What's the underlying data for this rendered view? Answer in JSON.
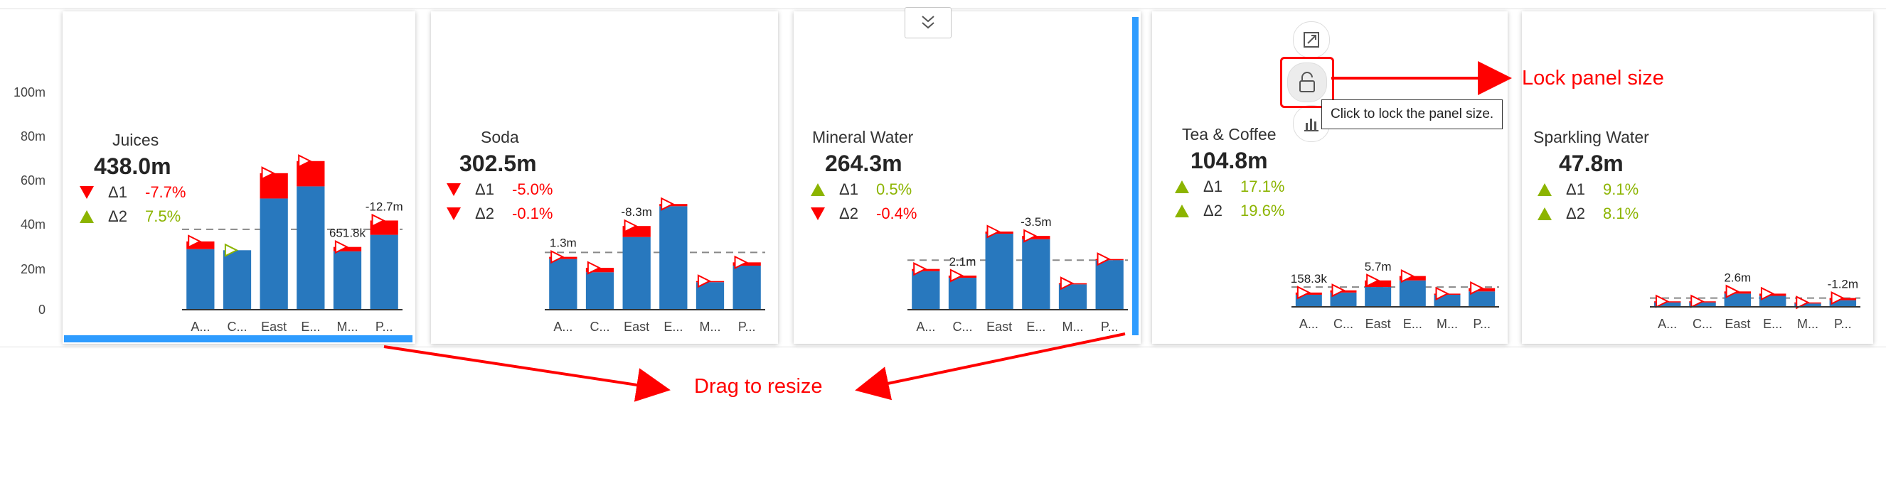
{
  "y_axis": {
    "ticks": [
      "100m",
      "80m",
      "60m",
      "40m",
      "20m",
      "0"
    ]
  },
  "panels": [
    {
      "title": "Juices",
      "total": "438.0m",
      "d1": {
        "label": "Δ1",
        "value": "-7.7%",
        "dir": "down"
      },
      "d2": {
        "label": "Δ2",
        "value": "7.5%",
        "dir": "up"
      }
    },
    {
      "title": "Soda",
      "total": "302.5m",
      "d1": {
        "label": "Δ1",
        "value": "-5.0%",
        "dir": "down"
      },
      "d2": {
        "label": "Δ2",
        "value": "-0.1%",
        "dir": "down"
      }
    },
    {
      "title": "Mineral Water",
      "total": "264.3m",
      "d1": {
        "label": "Δ1",
        "value": "0.5%",
        "dir": "up"
      },
      "d2": {
        "label": "Δ2",
        "value": "-0.4%",
        "dir": "down"
      }
    },
    {
      "title": "Tea & Coffee",
      "total": "104.8m",
      "d1": {
        "label": "Δ1",
        "value": "17.1%",
        "dir": "up"
      },
      "d2": {
        "label": "Δ2",
        "value": "19.6%",
        "dir": "up"
      }
    },
    {
      "title": "Sparkling Water",
      "total": "47.8m",
      "d1": {
        "label": "Δ1",
        "value": "9.1%",
        "dir": "up"
      },
      "d2": {
        "label": "Δ2",
        "value": "8.1%",
        "dir": "up"
      }
    }
  ],
  "chart_data": [
    {
      "type": "bar",
      "title": "Juices",
      "categories": [
        "A...",
        "C...",
        "East",
        "E...",
        "M...",
        "P..."
      ],
      "values": [
        55,
        54,
        101,
        112,
        53,
        68
      ],
      "ref": [
        62,
        54,
        124,
        135,
        57,
        81
      ],
      "avg": 73,
      "annotations": [
        {
          "index": 4,
          "text": "651.8k"
        },
        {
          "index": 5,
          "text": "-12.7m"
        }
      ],
      "ylim": [
        0,
        120
      ]
    },
    {
      "type": "bar",
      "title": "Soda",
      "categories": [
        "A...",
        "C...",
        "East",
        "E...",
        "M...",
        "P..."
      ],
      "values": [
        46,
        34,
        66,
        94,
        25,
        40
      ],
      "ref": [
        48,
        38,
        76,
        96,
        26,
        43
      ],
      "avg": 52,
      "annotations": [
        {
          "index": 0,
          "text": "1.3m"
        },
        {
          "index": 2,
          "text": "-8.3m"
        }
      ],
      "ylim": [
        0,
        120
      ]
    },
    {
      "type": "bar",
      "title": "Mineral Water",
      "categories": [
        "A...",
        "C...",
        "East",
        "E...",
        "M...",
        "P..."
      ],
      "values": [
        35,
        29,
        69,
        64,
        23,
        45
      ],
      "ref": [
        37,
        31,
        71,
        67,
        24,
        46
      ],
      "avg": 45,
      "annotations": [
        {
          "index": 1,
          "text": "2.1m"
        },
        {
          "index": 3,
          "text": "-3.5m"
        }
      ],
      "ylim": [
        0,
        120
      ]
    },
    {
      "type": "bar",
      "title": "Tea & Coffee",
      "categories": [
        "A...",
        "C...",
        "East",
        "E...",
        "M...",
        "P..."
      ],
      "values": [
        11,
        13,
        18,
        24,
        11,
        14
      ],
      "ref": [
        13,
        15,
        24,
        28,
        12,
        17
      ],
      "avg": 18,
      "annotations": [
        {
          "index": 0,
          "text": "158.3k"
        },
        {
          "index": 2,
          "text": "5.7m"
        }
      ],
      "ylim": [
        0,
        120
      ]
    },
    {
      "type": "bar",
      "title": "Sparkling Water",
      "categories": [
        "A...",
        "C...",
        "East",
        "E...",
        "M...",
        "P..."
      ],
      "values": [
        4,
        4,
        12,
        10,
        3,
        6
      ],
      "ref": [
        5,
        5,
        14,
        12,
        4,
        8
      ],
      "avg": 8,
      "annotations": [
        {
          "index": 2,
          "text": "2.6m"
        },
        {
          "index": 5,
          "text": "-1.2m"
        }
      ],
      "ylim": [
        0,
        120
      ]
    }
  ],
  "tooltip": "Click to lock the panel size.",
  "annotations": {
    "lock_label": "Lock panel size",
    "drag_label": "Drag to resize"
  },
  "colors": {
    "bar": "#2878be",
    "negative": "#ff0000",
    "positive": "#8cb400",
    "accent": "#2e9cff"
  },
  "icons": [
    "expand-icon",
    "lock-icon",
    "bar-chart-icon",
    "chevron-double-down-icon"
  ]
}
